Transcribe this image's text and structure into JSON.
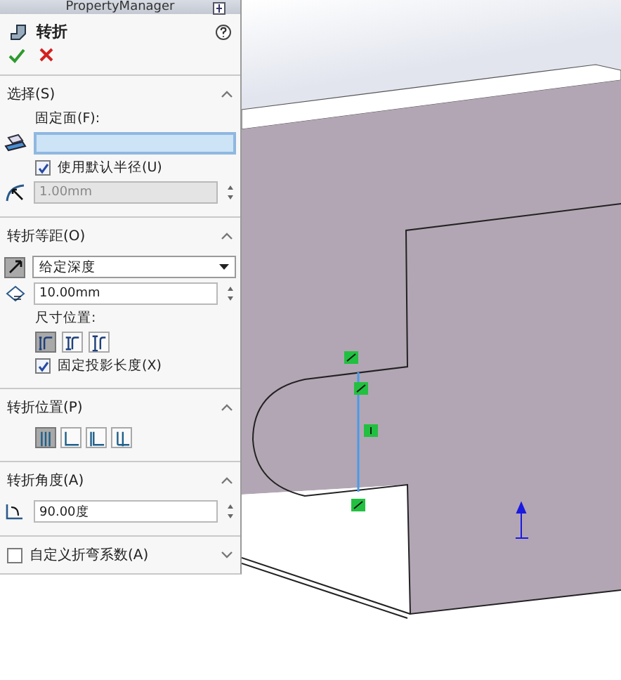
{
  "panel": {
    "header": "PropertyManager",
    "title": "转折"
  },
  "selection": {
    "title": "选择(S)",
    "expanded": true,
    "fixed_face_label": "固定面(F):",
    "face_field_active": true,
    "use_default_radius": {
      "label": "使用默认半径(U)",
      "checked": true
    },
    "radius": {
      "value": "1.00mm",
      "disabled": true
    }
  },
  "bend_distance": {
    "title": "转折等距(O)",
    "expanded": true,
    "end_condition": "给定深度",
    "distance": "10.00mm",
    "dimension_position_label": "尺寸位置:",
    "dimension_positions": [
      {
        "selected": true
      },
      {
        "selected": false
      },
      {
        "selected": false
      }
    ],
    "fix_projected_length": {
      "label": "固定投影长度(X)",
      "checked": true
    }
  },
  "bend_position": {
    "title": "转折位置(P)",
    "expanded": true,
    "options": [
      {
        "selected": true
      },
      {
        "selected": false
      },
      {
        "selected": false
      },
      {
        "selected": false
      }
    ]
  },
  "bend_angle": {
    "title": "转折角度(A)",
    "expanded": true,
    "angle": "90.00度"
  },
  "custom_bend_allowance": {
    "label": "自定义折弯系数(A)",
    "checked": false,
    "expanded": false
  }
}
